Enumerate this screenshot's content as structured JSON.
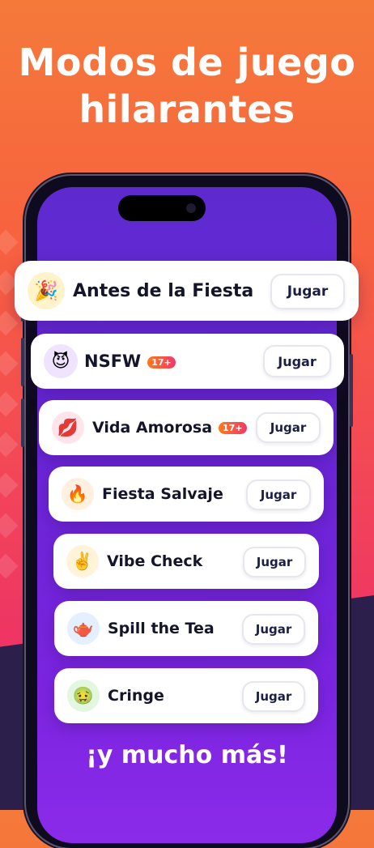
{
  "headline": {
    "line1": "Modos de juego",
    "line2": "hilarantes"
  },
  "modes": [
    {
      "title": "Antes de la Fiesta",
      "icon": "party-popper-icon",
      "glyph": "🎉",
      "icon_bg": "#fff3c9",
      "badge": null,
      "button": "Jugar"
    },
    {
      "title": "NSFW",
      "icon": "devil-face-icon",
      "glyph": "😈",
      "icon_bg": "#efe3ff",
      "badge": "17+",
      "button": "Jugar"
    },
    {
      "title": "Vida Amorosa",
      "icon": "kiss-lips-icon",
      "glyph": "💋",
      "icon_bg": "#ffe4ec",
      "badge": "17+",
      "button": "Jugar"
    },
    {
      "title": "Fiesta Salvaje",
      "icon": "fire-icon",
      "glyph": "🔥",
      "icon_bg": "#fff0e0",
      "badge": null,
      "button": "Jugar"
    },
    {
      "title": "Vibe Check",
      "icon": "victory-hand-icon",
      "glyph": "✌️",
      "icon_bg": "#fff3d9",
      "badge": null,
      "button": "Jugar"
    },
    {
      "title": "Spill the Tea",
      "icon": "teapot-icon",
      "glyph": "🫖",
      "icon_bg": "#e4efff",
      "badge": null,
      "button": "Jugar"
    },
    {
      "title": "Cringe",
      "icon": "woozy-face-icon",
      "glyph": "🤢",
      "icon_bg": "#e3f6df",
      "badge": null,
      "button": "Jugar"
    }
  ],
  "footer": "¡y mucho más!",
  "colors": {
    "background_top": "#f57a3a",
    "background_bottom": "#ee3563",
    "screen": "#6a25d6",
    "badge": "#f0386a",
    "button_text": "#1c1f44"
  }
}
